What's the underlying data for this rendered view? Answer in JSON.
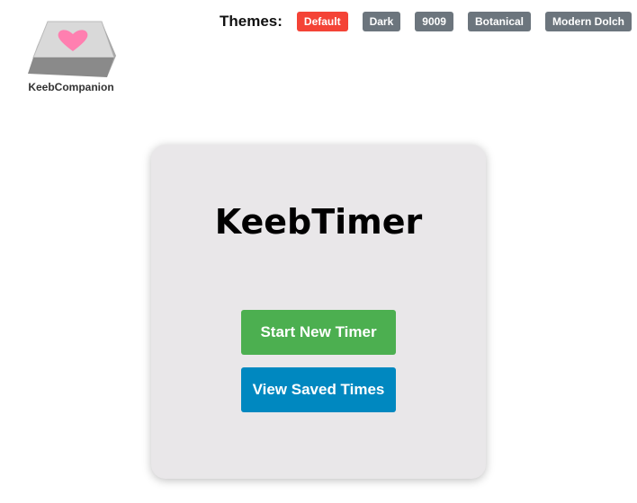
{
  "logo": {
    "text": "KeebCompanion"
  },
  "themes": {
    "label": "Themes:",
    "options": [
      {
        "label": "Default",
        "active": true
      },
      {
        "label": "Dark",
        "active": false
      },
      {
        "label": "9009",
        "active": false
      },
      {
        "label": "Botanical",
        "active": false
      },
      {
        "label": "Modern Dolch",
        "active": false
      }
    ]
  },
  "card": {
    "title": "KeebTimer",
    "start_label": "Start New Timer",
    "view_label": "View Saved Times"
  },
  "colors": {
    "active_theme": "#f44336",
    "inactive_theme": "#6c757d",
    "start_button": "#4caf50",
    "view_button": "#0088c0",
    "card_background": "#e9e7e9"
  }
}
